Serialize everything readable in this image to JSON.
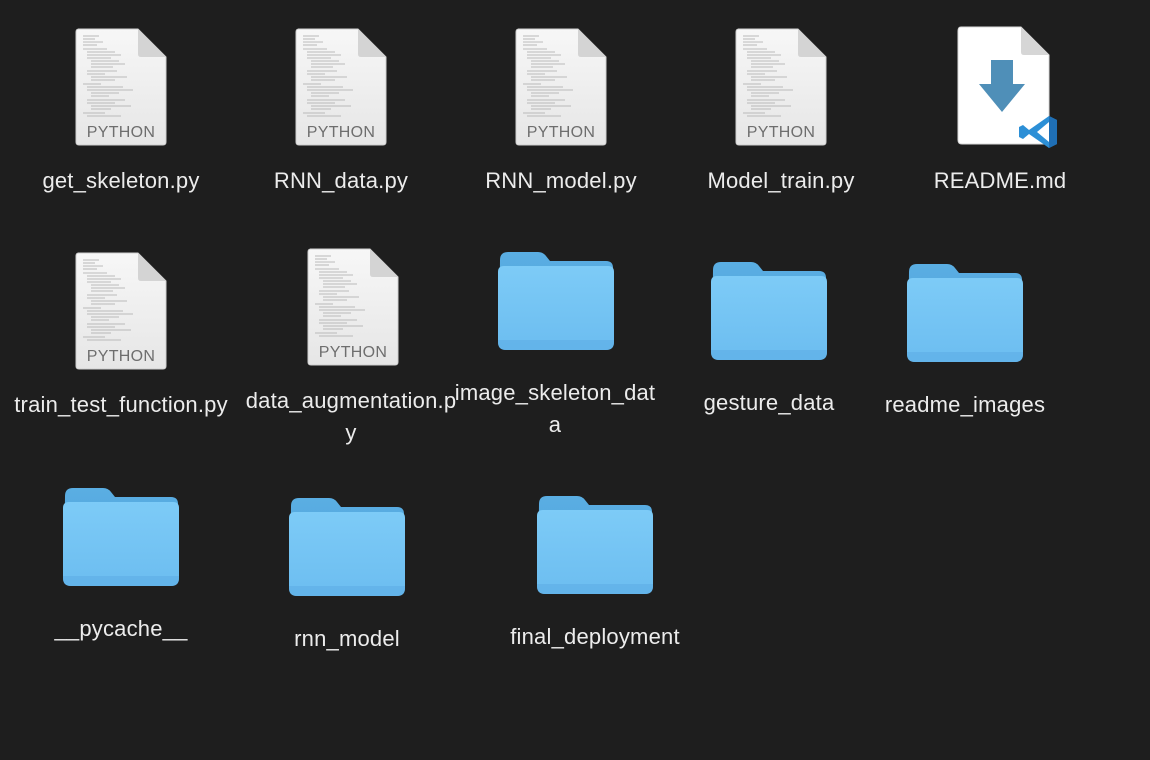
{
  "files": [
    {
      "name": "get_skeleton.py",
      "kind": "python",
      "badge": "PYTHON"
    },
    {
      "name": "RNN_data.py",
      "kind": "python",
      "badge": "PYTHON"
    },
    {
      "name": "RNN_model.py",
      "kind": "python",
      "badge": "PYTHON"
    },
    {
      "name": "Model_train.py",
      "kind": "python",
      "badge": "PYTHON"
    },
    {
      "name": "README.md",
      "kind": "markdown",
      "icon": "vscode-download-icon"
    },
    {
      "name": "train_test_function.py",
      "kind": "python",
      "badge": "PYTHON"
    },
    {
      "name": "data_augmentation.py",
      "kind": "python",
      "badge": "PYTHON"
    },
    {
      "name": "image_skeleton_data",
      "kind": "folder"
    },
    {
      "name": "gesture_data",
      "kind": "folder"
    },
    {
      "name": "readme_images",
      "kind": "folder"
    },
    {
      "name": "__pycache__",
      "kind": "folder"
    },
    {
      "name": "rnn_model",
      "kind": "folder"
    },
    {
      "name": "final_deployment",
      "kind": "folder"
    }
  ],
  "colors": {
    "background": "#1e1e1e",
    "folder": "#6cc0f2",
    "document": "#f2f2f2",
    "vscode_blue": "#2c8fd6",
    "download_arrow": "#4f8fb8"
  }
}
